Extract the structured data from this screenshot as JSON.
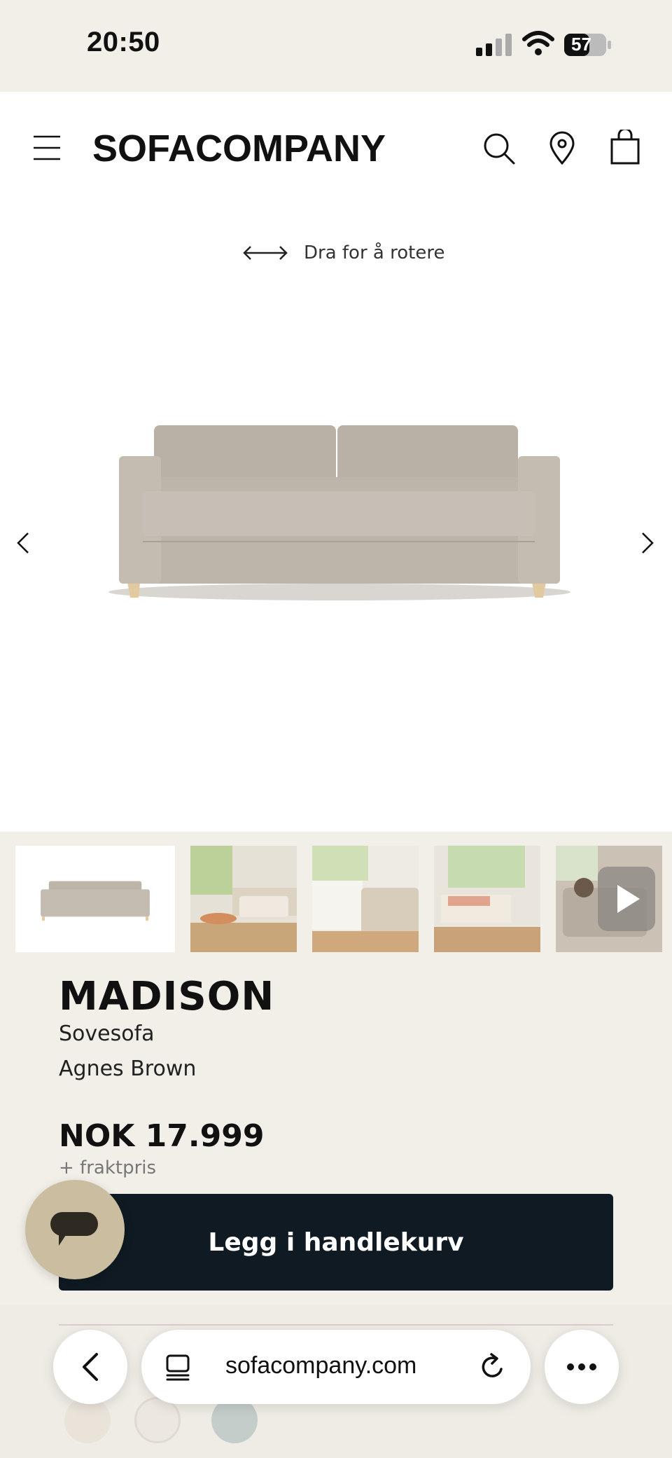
{
  "status_bar": {
    "time": "20:50",
    "battery": "57"
  },
  "header": {
    "logo": "SOFACOMPANY"
  },
  "hero": {
    "rotate_hint": "Dra for å rotere"
  },
  "product": {
    "title": "MADISON",
    "type": "Sovesofa",
    "fabric": "Agnes Brown",
    "price": "NOK 17.999",
    "shipping_note": "+ fraktpris",
    "add_to_cart_label": "Legg i handlekurv"
  },
  "browser": {
    "url": "sofacompany.com"
  },
  "colors": {
    "background": "#f2eee8",
    "button_dark": "#0f1a22",
    "chat_button": "#cbbd9f",
    "sofa_fabric": "#bdb4aa"
  },
  "icons": [
    "menu-icon",
    "search-icon",
    "location-pin-icon",
    "shopping-bag-icon",
    "rotate-arrows-icon",
    "chevron-left-icon",
    "chevron-right-icon",
    "play-icon",
    "chat-icon",
    "back-icon",
    "tabs-icon",
    "reload-icon",
    "more-icon"
  ]
}
